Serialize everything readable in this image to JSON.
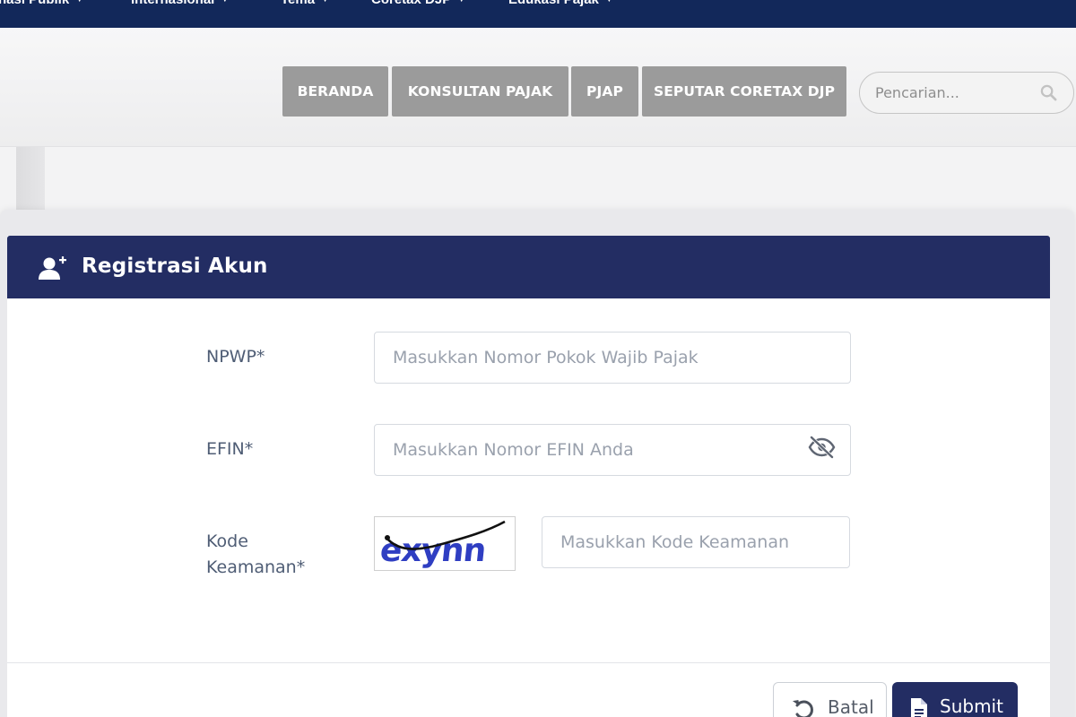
{
  "top_nav": {
    "items": [
      {
        "label": "nasi Publik"
      },
      {
        "label": "Internasional"
      },
      {
        "label": "Tema"
      },
      {
        "label": "Coretax DJP"
      },
      {
        "label": "Edukasi Pajak"
      }
    ]
  },
  "menu": {
    "items": [
      {
        "label": "BERANDA"
      },
      {
        "label": "KONSULTAN PAJAK"
      },
      {
        "label": "PJAP"
      },
      {
        "label": "SEPUTAR CORETAX DJP"
      }
    ]
  },
  "search": {
    "placeholder": "Pencarian..."
  },
  "form": {
    "title": "Registrasi Akun",
    "npwp": {
      "label": "NPWP*",
      "placeholder": "Masukkan Nomor Pokok Wajib Pajak",
      "value": ""
    },
    "efin": {
      "label": "EFIN*",
      "placeholder": "Masukkan Nomor EFIN Anda",
      "value": ""
    },
    "captcha": {
      "label_line1": "Kode",
      "label_line2": "Keamanan*",
      "image_text": "exynn",
      "placeholder": "Masukkan Kode Keamanan",
      "value": ""
    },
    "buttons": {
      "cancel_label": "Batal",
      "submit_label": "Submit"
    }
  },
  "colors": {
    "nav_bg": "#12285a",
    "card_header_bg": "#232d63",
    "menu_button_bg": "#9b9b9b",
    "label_color": "#4f5d75"
  },
  "icons": {
    "header": "user-plus-icon",
    "efin_toggle": "eye-slash-icon",
    "search": "search-icon",
    "cancel": "undo-icon",
    "submit": "file-icon"
  }
}
